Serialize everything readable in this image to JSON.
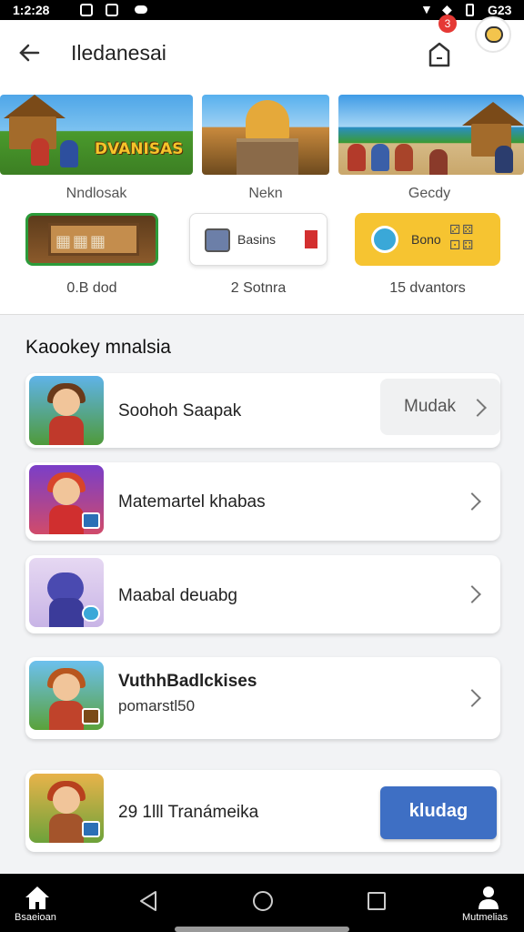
{
  "status_bar": {
    "time": "1:2:28",
    "battery_text": "G23"
  },
  "header": {
    "title": "Iledanesai",
    "notification_count": "3"
  },
  "featured": {
    "banners": [
      {
        "label": "Nndlosak",
        "title_art": "DVANISAS"
      },
      {
        "label": "Nekn"
      },
      {
        "label": "Gecdy"
      }
    ],
    "mini_cards": [
      {
        "text": "",
        "label": "0.B dod"
      },
      {
        "text": "Basins",
        "label": "2 Sotnra"
      },
      {
        "text": "Bono",
        "label": "15 dvantors"
      }
    ]
  },
  "section": {
    "title": "Kaookey mnalsia"
  },
  "list": [
    {
      "title": "Soohoh Saapak",
      "button": "Mudak"
    },
    {
      "title": "Matemartel khabas"
    },
    {
      "title": "Maabal deuabg"
    },
    {
      "title": "VuthhBadlckises",
      "subtitle": "pomarstl50"
    },
    {
      "title": "29 1lll Tranámeika",
      "button": "kludag"
    }
  ],
  "nav": {
    "left_label": "Bsaeioan",
    "right_label": "Mutmelias"
  },
  "colors": {
    "accent": "#3e6fc4",
    "badge": "#e53935",
    "gold_card": "#f6c431"
  },
  "icons": [
    "back-arrow-icon",
    "bell-icon",
    "avatar-icon",
    "chevron-right-icon",
    "home-icon",
    "profile-icon"
  ]
}
